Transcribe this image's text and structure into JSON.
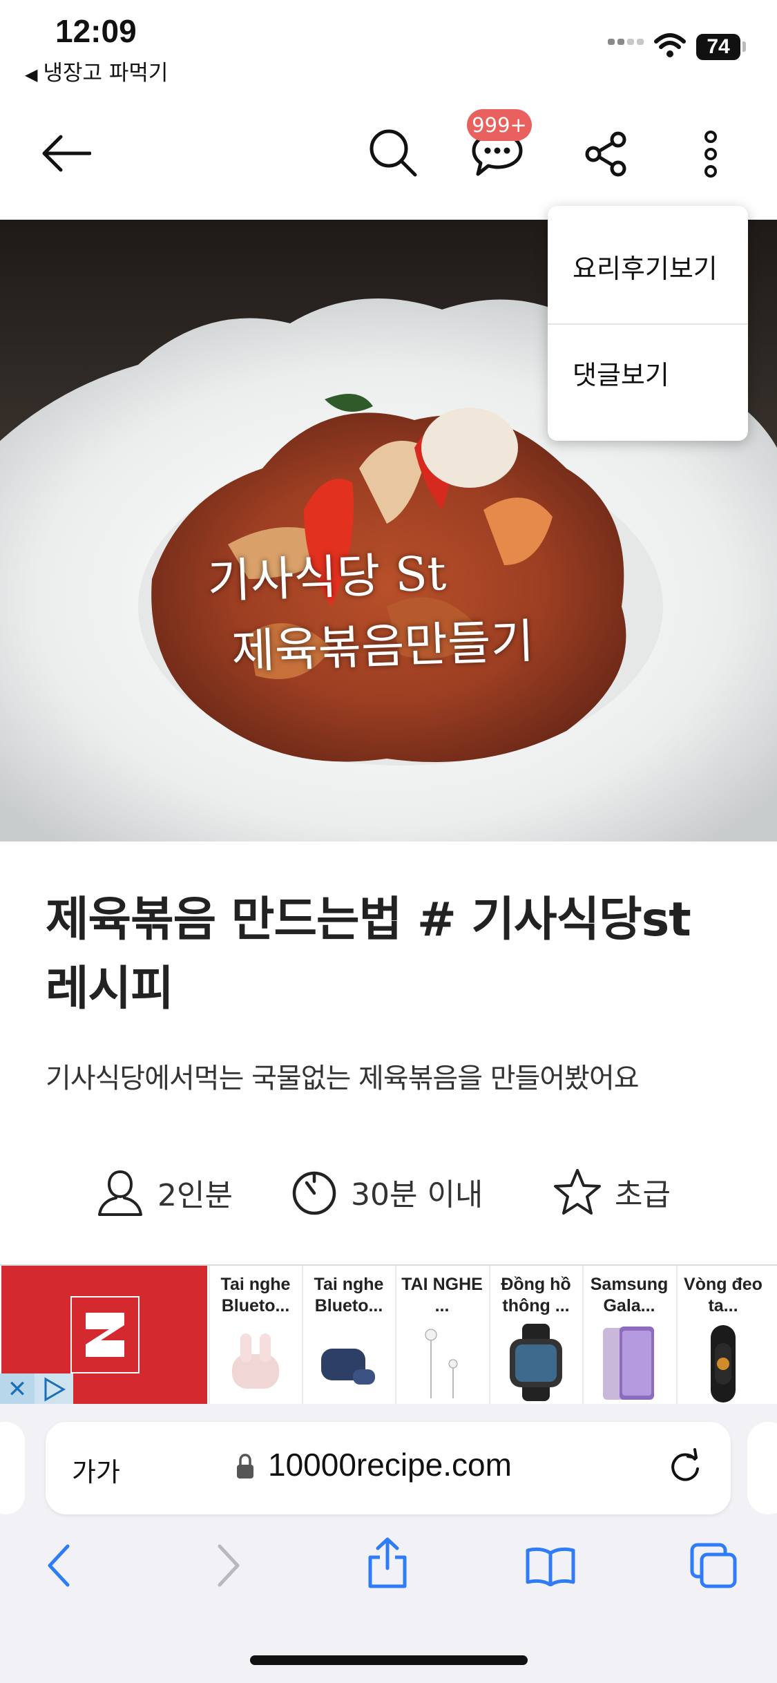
{
  "status_bar": {
    "time": "12:09",
    "back_app": "냉장고 파먹기",
    "battery": "74"
  },
  "header": {
    "chat_badge": "999+"
  },
  "hero": {
    "overlay_line1": "기사식당 St",
    "overlay_line2": "제육볶음만들기"
  },
  "menu": {
    "items": [
      {
        "label": "요리후기보기"
      },
      {
        "label": "댓글보기"
      }
    ]
  },
  "recipe": {
    "title": "제육볶음 만드는법 # 기사식당st 레시피",
    "subtitle": "기사식당에서먹는 국물없는 제육볶음을 만들어봤어요",
    "servings": "2인분",
    "time": "30분 이내",
    "difficulty": "초급"
  },
  "ad": {
    "items": [
      {
        "label": "Tai nghe Blueto..."
      },
      {
        "label": "Tai nghe Blueto..."
      },
      {
        "label": "TAI NGHE ..."
      },
      {
        "label": "Đồng hồ thông ..."
      },
      {
        "label": "Samsung Gala..."
      },
      {
        "label": "Vòng đeo ta..."
      }
    ]
  },
  "browser": {
    "text_size": "가가",
    "url": "10000recipe.com"
  },
  "colors": {
    "badge": "#e8615e",
    "ios_blue": "#2f7cf6",
    "ad_red": "#d3292f"
  }
}
